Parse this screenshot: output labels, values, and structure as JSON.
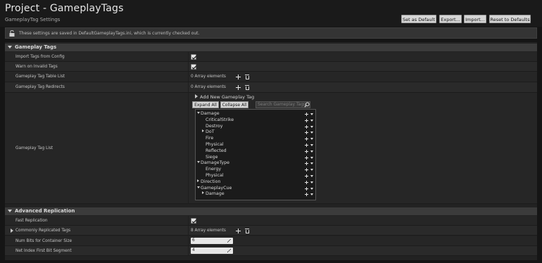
{
  "header": {
    "title": "Project - GameplayTags",
    "subtitle": "GameplayTag Settings",
    "buttons": {
      "set_default": "Set as Default",
      "export": "Export...",
      "import": "Import...",
      "reset": "Reset to Defaults"
    }
  },
  "notice": {
    "icon": "lock-icon",
    "text": "These settings are saved in DefaultGameplayTags.ini, which is currently checked out."
  },
  "gameplay_tags_section": {
    "title": "Gameplay Tags",
    "import_tags_label": "Import Tags from Config",
    "import_tags_checked": true,
    "warn_invalid_label": "Warn on Invalid Tags",
    "warn_invalid_checked": true,
    "table_list_label": "Gameplay Tag Table List",
    "table_list_value": "0 Array elements",
    "redirects_label": "Gameplay Tag Redirects",
    "redirects_value": "0 Array elements",
    "tag_list_label": "Gameplay Tag List",
    "add_new_tag": "Add New Gameplay Tag",
    "expand_all": "Expand All",
    "collapse_all": "Collapse All",
    "search_placeholder": "Search Gameplay Tags",
    "tree": [
      {
        "label": "Damage",
        "depth": 0,
        "caret": "open"
      },
      {
        "label": "CriticalStrike",
        "depth": 1,
        "caret": "none"
      },
      {
        "label": "Destroy",
        "depth": 1,
        "caret": "none"
      },
      {
        "label": "DoT",
        "depth": 1,
        "caret": "closed"
      },
      {
        "label": "Fire",
        "depth": 1,
        "caret": "none"
      },
      {
        "label": "Physical",
        "depth": 1,
        "caret": "none"
      },
      {
        "label": "Reflected",
        "depth": 1,
        "caret": "none"
      },
      {
        "label": "Siege",
        "depth": 1,
        "caret": "none"
      },
      {
        "label": "DamageType",
        "depth": 0,
        "caret": "open"
      },
      {
        "label": "Energy",
        "depth": 1,
        "caret": "none"
      },
      {
        "label": "Physical",
        "depth": 1,
        "caret": "none"
      },
      {
        "label": "Direction",
        "depth": 0,
        "caret": "closed"
      },
      {
        "label": "GameplayCue",
        "depth": 0,
        "caret": "open"
      },
      {
        "label": "Damage",
        "depth": 1,
        "caret": "closed"
      }
    ]
  },
  "replication_section": {
    "title": "Advanced Replication",
    "fast_replication_label": "Fast Replication",
    "fast_replication_checked": true,
    "commonly_replicated_label": "Commonly Replicated Tags",
    "commonly_replicated_value": "8 Array elements",
    "num_bits_label": "Num Bits for Container Size",
    "num_bits_value": "6",
    "net_index_label": "Net Index First Bit Segment",
    "net_index_value": "4"
  }
}
